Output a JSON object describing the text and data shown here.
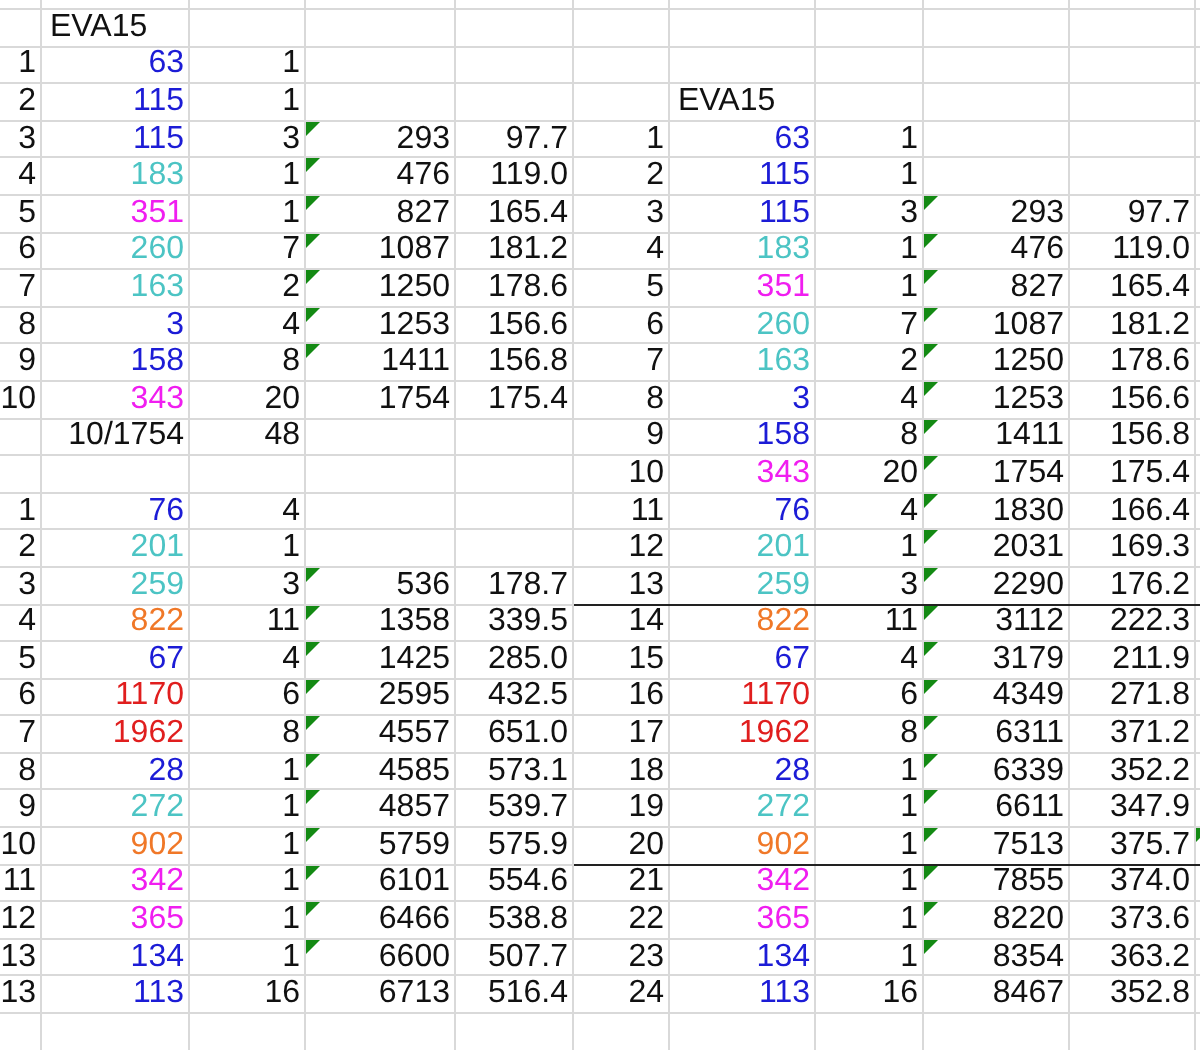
{
  "left_table": {
    "title": "EVA15",
    "rows": [
      {
        "index": "1",
        "value": "63",
        "color": "#1c1cd6",
        "count": "1",
        "error_mark": false
      },
      {
        "index": "2",
        "value": "115",
        "color": "#1c1cd6",
        "count": "1",
        "error_mark": false
      },
      {
        "index": "3",
        "value": "115",
        "color": "#1c1cd6",
        "count": "3",
        "total": "293",
        "average": "97.7",
        "error_mark": true
      },
      {
        "index": "4",
        "value": "183",
        "color": "#4cc4c4",
        "count": "1",
        "total": "476",
        "average": "119.0",
        "error_mark": true
      },
      {
        "index": "5",
        "value": "351",
        "color": "#f01ef0",
        "count": "1",
        "total": "827",
        "average": "165.4",
        "error_mark": true
      },
      {
        "index": "6",
        "value": "260",
        "color": "#4cc4c4",
        "count": "7",
        "total": "1087",
        "average": "181.2",
        "error_mark": true
      },
      {
        "index": "7",
        "value": "163",
        "color": "#4cc4c4",
        "count": "2",
        "total": "1250",
        "average": "178.6",
        "error_mark": true
      },
      {
        "index": "8",
        "value": "3",
        "color": "#1c1cd6",
        "count": "4",
        "total": "1253",
        "average": "156.6",
        "error_mark": true
      },
      {
        "index": "9",
        "value": "158",
        "color": "#1c1cd6",
        "count": "8",
        "total": "1411",
        "average": "156.8",
        "error_mark": true
      },
      {
        "index": "10",
        "value": "343",
        "color": "#f01ef0",
        "count": "20",
        "total": "1754",
        "average": "175.4",
        "error_mark": false
      }
    ],
    "summary": {
      "label": "10/1754",
      "count": "48"
    }
  },
  "second_table": {
    "rows": [
      {
        "index": "1",
        "value": "76",
        "color": "#1c1cd6",
        "count": "4",
        "error_mark": false
      },
      {
        "index": "2",
        "value": "201",
        "color": "#4cc4c4",
        "count": "1",
        "error_mark": false
      },
      {
        "index": "3",
        "value": "259",
        "color": "#4cc4c4",
        "count": "3",
        "total": "536",
        "average": "178.7",
        "error_mark": true
      },
      {
        "index": "4",
        "value": "822",
        "color": "#f07828",
        "count": "11",
        "total": "1358",
        "average": "339.5",
        "error_mark": true
      },
      {
        "index": "5",
        "value": "67",
        "color": "#1c1cd6",
        "count": "4",
        "total": "1425",
        "average": "285.0",
        "error_mark": true
      },
      {
        "index": "6",
        "value": "1170",
        "color": "#e01e1e",
        "count": "6",
        "total": "2595",
        "average": "432.5",
        "error_mark": true
      },
      {
        "index": "7",
        "value": "1962",
        "color": "#e01e1e",
        "count": "8",
        "total": "4557",
        "average": "651.0",
        "error_mark": true
      },
      {
        "index": "8",
        "value": "28",
        "color": "#1c1cd6",
        "count": "1",
        "total": "4585",
        "average": "573.1",
        "error_mark": true
      },
      {
        "index": "9",
        "value": "272",
        "color": "#4cc4c4",
        "count": "1",
        "total": "4857",
        "average": "539.7",
        "error_mark": true
      },
      {
        "index": "10",
        "value": "902",
        "color": "#f07828",
        "count": "1",
        "total": "5759",
        "average": "575.9",
        "error_mark": true
      },
      {
        "index": "11",
        "value": "342",
        "color": "#f01ef0",
        "count": "1",
        "total": "6101",
        "average": "554.6",
        "error_mark": true
      },
      {
        "index": "12",
        "value": "365",
        "color": "#f01ef0",
        "count": "1",
        "total": "6466",
        "average": "538.8",
        "error_mark": true
      },
      {
        "index": "13",
        "value": "134",
        "color": "#1c1cd6",
        "count": "1",
        "total": "6600",
        "average": "507.7",
        "error_mark": true
      },
      {
        "index": "13",
        "value": "113",
        "color": "#1c1cd6",
        "count": "16",
        "total": "6713",
        "average": "516.4",
        "error_mark": false
      }
    ]
  },
  "right_table": {
    "title": "EVA15",
    "rows": [
      {
        "index": "1",
        "value": "63",
        "color": "#1c1cd6",
        "count": "1",
        "error_mark": false,
        "edge_mark": false,
        "rule_below": false
      },
      {
        "index": "2",
        "value": "115",
        "color": "#1c1cd6",
        "count": "1",
        "error_mark": false,
        "edge_mark": false,
        "rule_below": false
      },
      {
        "index": "3",
        "value": "115",
        "color": "#1c1cd6",
        "count": "3",
        "total": "293",
        "average": "97.7",
        "error_mark": true,
        "edge_mark": false,
        "rule_below": false
      },
      {
        "index": "4",
        "value": "183",
        "color": "#4cc4c4",
        "count": "1",
        "total": "476",
        "average": "119.0",
        "error_mark": true,
        "edge_mark": false,
        "rule_below": false
      },
      {
        "index": "5",
        "value": "351",
        "color": "#f01ef0",
        "count": "1",
        "total": "827",
        "average": "165.4",
        "error_mark": true,
        "edge_mark": false,
        "rule_below": false
      },
      {
        "index": "6",
        "value": "260",
        "color": "#4cc4c4",
        "count": "7",
        "total": "1087",
        "average": "181.2",
        "error_mark": true,
        "edge_mark": false,
        "rule_below": false
      },
      {
        "index": "7",
        "value": "163",
        "color": "#4cc4c4",
        "count": "2",
        "total": "1250",
        "average": "178.6",
        "error_mark": true,
        "edge_mark": false,
        "rule_below": false
      },
      {
        "index": "8",
        "value": "3",
        "color": "#1c1cd6",
        "count": "4",
        "total": "1253",
        "average": "156.6",
        "error_mark": true,
        "edge_mark": false,
        "rule_below": false
      },
      {
        "index": "9",
        "value": "158",
        "color": "#1c1cd6",
        "count": "8",
        "total": "1411",
        "average": "156.8",
        "error_mark": true,
        "edge_mark": false,
        "rule_below": false
      },
      {
        "index": "10",
        "value": "343",
        "color": "#f01ef0",
        "count": "20",
        "total": "1754",
        "average": "175.4",
        "error_mark": true,
        "edge_mark": false,
        "rule_below": false
      },
      {
        "index": "11",
        "value": "76",
        "color": "#1c1cd6",
        "count": "4",
        "total": "1830",
        "average": "166.4",
        "error_mark": true,
        "edge_mark": false,
        "rule_below": false
      },
      {
        "index": "12",
        "value": "201",
        "color": "#4cc4c4",
        "count": "1",
        "total": "2031",
        "average": "169.3",
        "error_mark": true,
        "edge_mark": false,
        "rule_below": false
      },
      {
        "index": "13",
        "value": "259",
        "color": "#4cc4c4",
        "count": "3",
        "total": "2290",
        "average": "176.2",
        "error_mark": true,
        "edge_mark": false,
        "rule_below": true
      },
      {
        "index": "14",
        "value": "822",
        "color": "#f07828",
        "count": "11",
        "total": "3112",
        "average": "222.3",
        "error_mark": true,
        "edge_mark": false,
        "rule_below": false
      },
      {
        "index": "15",
        "value": "67",
        "color": "#1c1cd6",
        "count": "4",
        "total": "3179",
        "average": "211.9",
        "error_mark": true,
        "edge_mark": false,
        "rule_below": false
      },
      {
        "index": "16",
        "value": "1170",
        "color": "#e01e1e",
        "count": "6",
        "total": "4349",
        "average": "271.8",
        "error_mark": true,
        "edge_mark": false,
        "rule_below": false
      },
      {
        "index": "17",
        "value": "1962",
        "color": "#e01e1e",
        "count": "8",
        "total": "6311",
        "average": "371.2",
        "error_mark": true,
        "edge_mark": false,
        "rule_below": false
      },
      {
        "index": "18",
        "value": "28",
        "color": "#1c1cd6",
        "count": "1",
        "total": "6339",
        "average": "352.2",
        "error_mark": true,
        "edge_mark": false,
        "rule_below": false
      },
      {
        "index": "19",
        "value": "272",
        "color": "#4cc4c4",
        "count": "1",
        "total": "6611",
        "average": "347.9",
        "error_mark": true,
        "edge_mark": false,
        "rule_below": false
      },
      {
        "index": "20",
        "value": "902",
        "color": "#f07828",
        "count": "1",
        "total": "7513",
        "average": "375.7",
        "error_mark": true,
        "edge_mark": true,
        "rule_below": true
      },
      {
        "index": "21",
        "value": "342",
        "color": "#f01ef0",
        "count": "1",
        "total": "7855",
        "average": "374.0",
        "error_mark": true,
        "edge_mark": false,
        "rule_below": false
      },
      {
        "index": "22",
        "value": "365",
        "color": "#f01ef0",
        "count": "1",
        "total": "8220",
        "average": "373.6",
        "error_mark": true,
        "edge_mark": false,
        "rule_below": false
      },
      {
        "index": "23",
        "value": "134",
        "color": "#1c1cd6",
        "count": "1",
        "total": "8354",
        "average": "363.2",
        "error_mark": true,
        "edge_mark": false,
        "rule_below": false
      },
      {
        "index": "24",
        "value": "113",
        "color": "#1c1cd6",
        "count": "16",
        "total": "8467",
        "average": "352.8",
        "error_mark": false,
        "edge_mark": false,
        "rule_below": false
      }
    ]
  }
}
